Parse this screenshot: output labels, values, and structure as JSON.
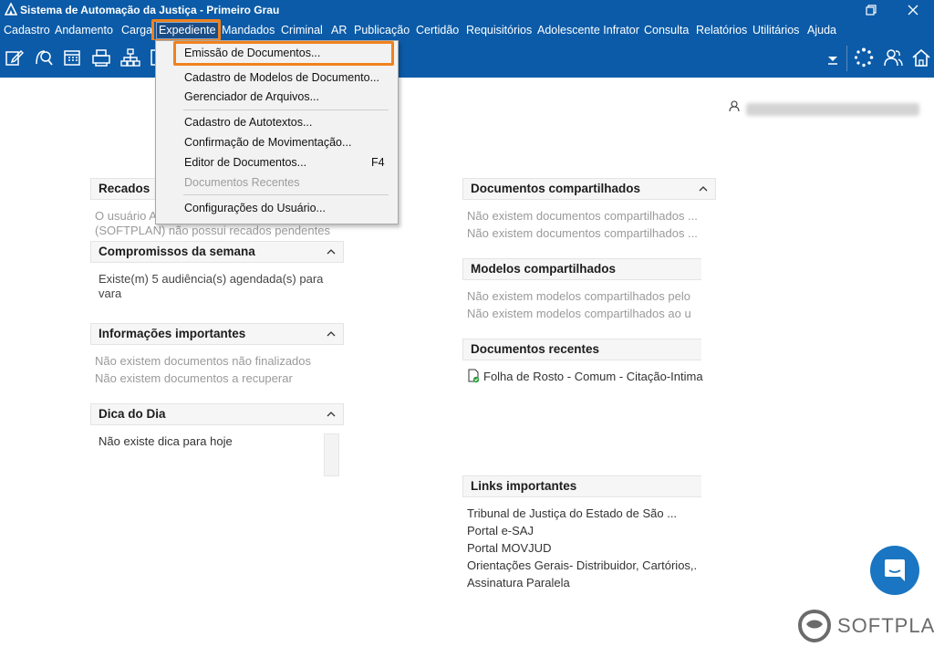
{
  "window": {
    "title": "Sistema de Automação da Justiça - Primeiro Grau",
    "restore_icon": "restore-icon",
    "close_icon": "close-icon"
  },
  "menubar": {
    "items": [
      "Cadastro",
      "Andamento",
      "Carga",
      "Expediente",
      "Mandados",
      "Criminal",
      "AR",
      "Publicação",
      "Certidão",
      "Requisitórios",
      "Adolescente Infrator",
      "Consulta",
      "Relatórios",
      "Utilitários",
      "Ajuda"
    ],
    "active": "Expediente"
  },
  "dropdown": {
    "items": [
      {
        "label": "Emissão de Documentos...",
        "highlighted": true
      },
      {
        "label": "Cadastro de Modelos de Documento..."
      },
      {
        "label": "Gerenciador de Arquivos..."
      },
      {
        "label": "Cadastro de Autotextos..."
      },
      {
        "label": "Confirmação de Movimentação..."
      },
      {
        "label": "Editor de Documentos...",
        "shortcut": "F4"
      },
      {
        "label": "Documentos Recentes",
        "disabled": true
      },
      {
        "label": "Configurações do Usuário..."
      }
    ]
  },
  "left": {
    "recados": {
      "title": "Recados",
      "line1": "O usuário A",
      "line2": "(SOFTPLAN) não possui recados pendentes"
    },
    "compromissos": {
      "title": "Compromissos da semana",
      "line1": "Existe(m) 5 audiência(s) agendada(s) para",
      "line2": "vara"
    },
    "informacoes": {
      "title": "Informações importantes",
      "line1": "Não existem documentos não finalizados",
      "line2": "Não existem documentos a recuperar"
    },
    "dica": {
      "title": "Dica do Dia",
      "line1": "Não existe dica para hoje"
    }
  },
  "right": {
    "doc_compartilhados": {
      "title": "Documentos compartilhados",
      "line1": "Não existem documentos compartilhados ...",
      "line2": "Não existem documentos compartilhados ..."
    },
    "modelos": {
      "title": "Modelos compartilhados",
      "line1": "Não existem modelos compartilhados pelo",
      "line2": "Não existem modelos compartilhados ao u"
    },
    "recentes": {
      "title": "Documentos recentes",
      "item1": "Folha de Rosto - Comum - Citação-Intima"
    },
    "links": {
      "title": "Links importantes",
      "items": [
        "Tribunal de Justiça do Estado de São ...",
        "Portal e-SAJ",
        "Portal MOVJUD",
        "Orientações Gerais- Distribuidor, Cartórios,.",
        "Assinatura Paralela"
      ]
    }
  },
  "brand": {
    "name": "SOFTPLAN"
  },
  "colors": {
    "primary": "#0b5ba8",
    "highlight": "#f0821e"
  }
}
